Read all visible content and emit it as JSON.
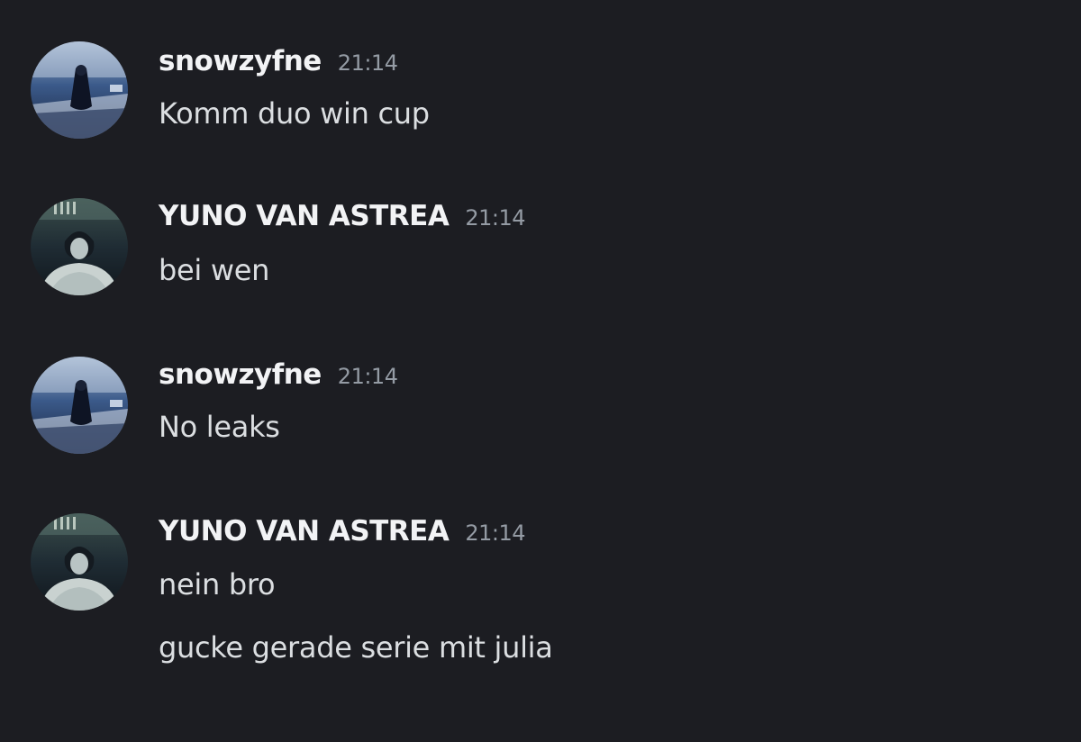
{
  "messages": [
    {
      "author": "snowzyfne",
      "time": "21:14",
      "avatar": "cloaked-figure-avatar",
      "lines": [
        "Komm duo win cup"
      ]
    },
    {
      "author": "YUNO VAN ASTREA",
      "time": "21:14",
      "avatar": "anime-character-avatar",
      "lines": [
        "bei wen"
      ]
    },
    {
      "author": "snowzyfne",
      "time": "21:14",
      "avatar": "cloaked-figure-avatar",
      "lines": [
        "No leaks"
      ]
    },
    {
      "author": "YUNO VAN ASTREA",
      "time": "21:14",
      "avatar": "anime-character-avatar",
      "lines": [
        "nein bro",
        "gucke gerade serie mit julia"
      ]
    }
  ],
  "colors": {
    "background": "#1c1d22",
    "username": "#f2f3f5",
    "timestamp": "#949ba4",
    "text": "#dbdee1"
  }
}
